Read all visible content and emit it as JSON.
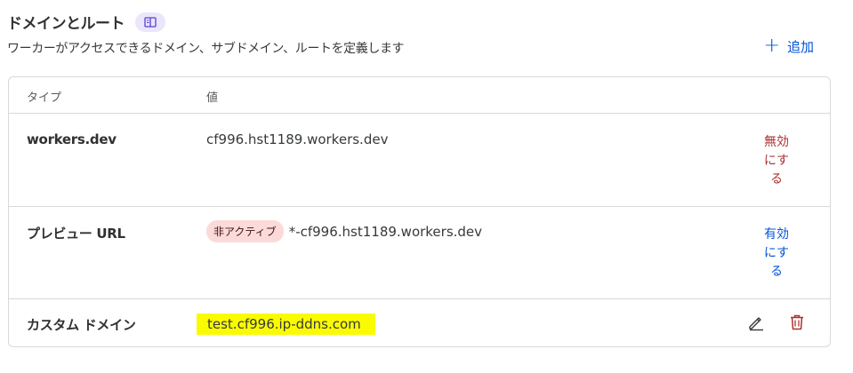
{
  "header": {
    "title": "ドメインとルート",
    "subtitle": "ワーカーがアクセスできるドメイン、サブドメイン、ルートを定義します",
    "add_label": "追加",
    "icons": {
      "docs": "book-icon",
      "add": "plus-icon"
    }
  },
  "table": {
    "columns": [
      "タイプ",
      "値"
    ],
    "rows": [
      {
        "type": "workers.dev",
        "value": "cf996.hst1189.workers.dev",
        "action": "無効にする"
      },
      {
        "type": "プレビュー URL",
        "badge": "非アクティブ",
        "value": "*-cf996.hst1189.workers.dev",
        "action": "有効にする"
      },
      {
        "type": "カスタム ドメイン",
        "value": "test.cf996.ip-ddns.com",
        "icons": [
          "pencil-icon",
          "trash-icon"
        ]
      }
    ]
  },
  "colors": {
    "accent": "#0055dc",
    "danger": "#ae2f2f",
    "highlight": "#fbfb00",
    "badge_bg": "#fcdada"
  }
}
